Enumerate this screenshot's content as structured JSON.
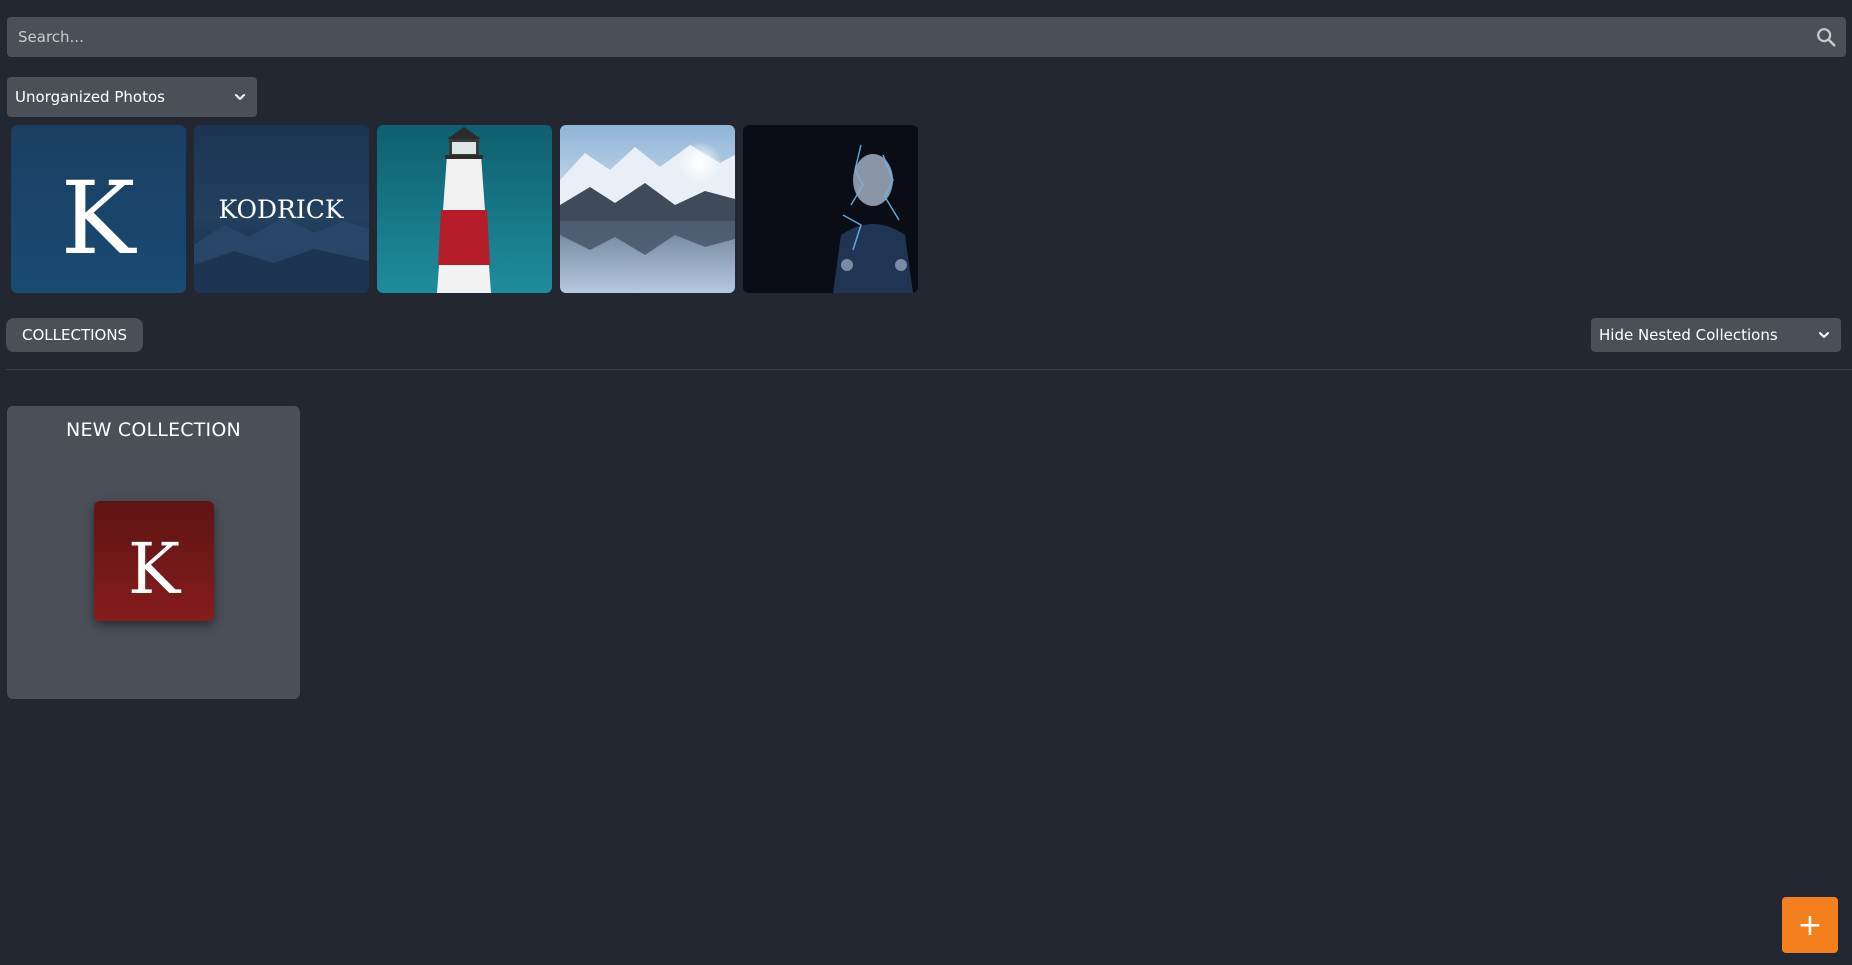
{
  "search": {
    "placeholder": "Search..."
  },
  "album_filter": {
    "selected": "Unorganized Photos"
  },
  "photos": [
    {
      "name": "K logo blue"
    },
    {
      "name": "KODRICK banner",
      "text": "KODRICK"
    },
    {
      "name": "lighthouse"
    },
    {
      "name": "mountain lake"
    },
    {
      "name": "portrait dark"
    }
  ],
  "collections_section": {
    "button_label": "COLLECTIONS",
    "nested_filter": {
      "selected": "Hide Nested Collections"
    }
  },
  "collections": [
    {
      "title": "NEW COLLECTION"
    }
  ],
  "fab": {
    "label": "+"
  },
  "colors": {
    "background": "#222731",
    "surface": "#4a4f58",
    "accent": "#f47f1d",
    "collection_cover": "#7a1a1a"
  }
}
